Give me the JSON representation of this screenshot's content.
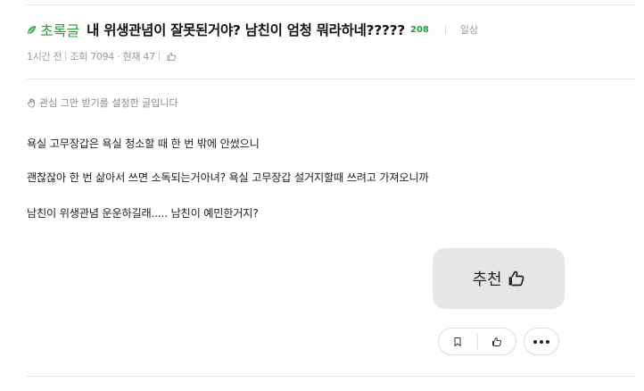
{
  "post": {
    "board": "초록글",
    "title": "내 위생관념이 잘못된거야? 남친이 엄청 뭐라하네?????",
    "comment_count": "208",
    "category": "일상",
    "time_ago": "1시간 전",
    "views": "조회 7094",
    "current": "현재 47",
    "notice": "관심 그만 받기를 설정한 글입니다",
    "body": [
      "욕실 고무장갑은 욕실 청소할 때 한 번 밖에 안썼으니",
      "괜찮잖아 한 번 삶아서 쓰면 소독되는거아녀? 욕실 고무장갑 설거지할때 쓰려고 가져오니까",
      "남친이 위생관념 운운하길래..... 남친이 예민한거지?"
    ]
  },
  "actions": {
    "recommend_label": "추천"
  },
  "icons": {
    "leaf": "leaf-icon",
    "thumb": "thumbs-up-icon",
    "bookmark": "bookmark-icon",
    "hand": "hand-icon",
    "more": "more-dots-icon"
  },
  "colors": {
    "accent_green": "#1fa33a",
    "button_gray": "#e6e6e6"
  }
}
